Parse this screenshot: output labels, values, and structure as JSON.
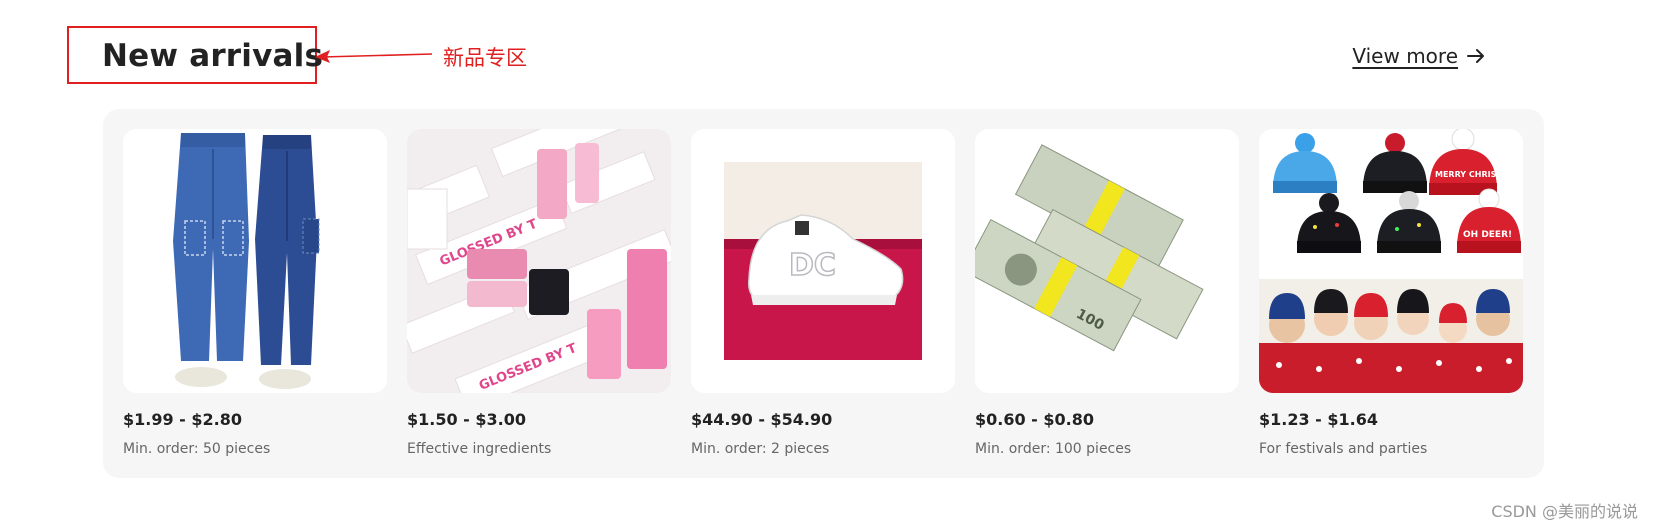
{
  "section": {
    "title": "New arrivals",
    "view_more_label": "View more",
    "view_more_icon": "arrow-right-icon"
  },
  "annotation": {
    "label": "新品专区",
    "color": "#e02020"
  },
  "products": [
    {
      "price": "$1.99 - $2.80",
      "detail": "Min. order: 50 pieces",
      "image": "denim-cargo-jeans"
    },
    {
      "price": "$1.50 - $3.00",
      "detail": "Effective ingredients",
      "image": "lip-gloss-tubes",
      "image_text": "GLOSSED BY T"
    },
    {
      "price": "$44.90 - $54.90",
      "detail": "Min. order: 2 pieces",
      "image": "white-dc-sneaker",
      "image_text": "DC"
    },
    {
      "price": "$0.60 - $0.80",
      "detail": "Min. order: 100 pieces",
      "image": "prop-money-stacks",
      "image_text": "100"
    },
    {
      "price": "$1.23 - $1.64",
      "detail": "For festivals and parties",
      "image": "christmas-led-beanies",
      "image_text": [
        "MERRY CHRISTMAS",
        "OH DEER!"
      ]
    }
  ],
  "watermark": "CSDN @美丽的说说"
}
